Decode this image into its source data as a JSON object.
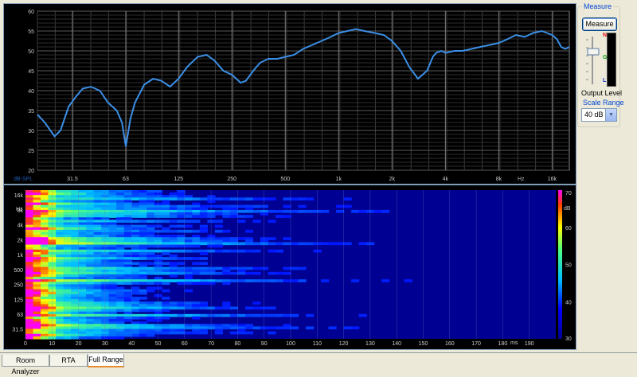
{
  "freq_chart": {
    "y_ticks": [
      "60",
      "55",
      "50",
      "45",
      "40",
      "35",
      "30",
      "25",
      "20"
    ],
    "y_unit": "dB-SPL",
    "x_ticks": [
      "31.5",
      "63",
      "125",
      "250",
      "500",
      "1k",
      "2k",
      "4k",
      "8k",
      "16k"
    ],
    "x_unit": "Hz",
    "curve_color": "#3b8fe6",
    "chart_data": {
      "type": "line",
      "title": "",
      "xlabel": "Hz",
      "ylabel": "dB-SPL",
      "xscale": "log",
      "xlim": [
        20,
        20000
      ],
      "ylim": [
        20,
        60
      ],
      "grid": true,
      "series": [
        {
          "x": [
            20,
            22,
            25,
            27,
            30,
            33,
            36,
            40,
            45,
            50,
            56,
            60,
            63,
            67,
            71,
            80,
            90,
            100,
            112,
            125,
            140,
            160,
            180,
            200,
            224,
            250,
            280,
            300,
            330,
            360,
            400,
            450,
            500,
            560,
            630,
            710,
            800,
            900,
            1000,
            1120,
            1250,
            1400,
            1600,
            1800,
            2000,
            2240,
            2500,
            2800,
            3150,
            3400,
            3550,
            3800,
            4000,
            4500,
            5000,
            5600,
            6300,
            7100,
            8000,
            9000,
            10000,
            11200,
            12500,
            14000,
            16000,
            17000,
            18000,
            19000,
            20000
          ],
          "y": [
            34,
            32,
            28.5,
            30,
            36,
            38.5,
            40.5,
            41,
            40,
            37,
            35,
            32,
            26,
            33,
            37,
            41.5,
            43,
            42.5,
            41,
            43,
            46,
            48.5,
            49,
            47.5,
            45,
            44,
            42,
            42.5,
            45,
            47,
            48,
            48,
            48.5,
            49,
            50.5,
            51.5,
            52.5,
            53.5,
            54.5,
            55,
            55.5,
            55,
            54.5,
            54,
            52.5,
            50,
            46,
            43,
            45,
            48.5,
            49.5,
            50,
            49.5,
            50,
            50,
            50.5,
            51,
            51.5,
            52,
            53,
            54,
            53.5,
            54.5,
            55,
            54,
            53,
            51,
            50.5,
            51
          ]
        }
      ]
    }
  },
  "spectrogram": {
    "y_ticks": [
      "16k",
      "8k",
      "4k",
      "2k",
      "1k",
      "500",
      "250",
      "125",
      "63",
      "31.5"
    ],
    "y_unit": "Hz",
    "x_ticks": [
      "0",
      "10",
      "20",
      "30",
      "40",
      "50",
      "60",
      "70",
      "80",
      "90",
      "100",
      "110",
      "120",
      "130",
      "140",
      "150",
      "160",
      "170",
      "180",
      "190"
    ],
    "x_unit": "ms",
    "colorbar_ticks": [
      "70",
      "60",
      "50",
      "40",
      "30"
    ],
    "colorbar_unit": "dB",
    "chart_data": {
      "type": "heatmap",
      "title": "",
      "xlabel": "ms",
      "ylabel": "Hz",
      "xlim": [
        0,
        200
      ],
      "ylim": [
        20,
        20000
      ],
      "clim": [
        30,
        70
      ],
      "grid": true
    }
  },
  "measure": {
    "group_label": "Measure",
    "button_label": "Measure",
    "output_level_label": "Output Level",
    "meter_top_label": "N",
    "meter_mid_label": "G",
    "meter_bottom_label": "L",
    "scale_range_label": "Scale Range",
    "scale_range_value": "40 dB"
  },
  "tabs": [
    {
      "label": "Room Analyzer",
      "active": false
    },
    {
      "label": "RTA",
      "active": false
    },
    {
      "label": "Full Range",
      "active": true
    }
  ]
}
